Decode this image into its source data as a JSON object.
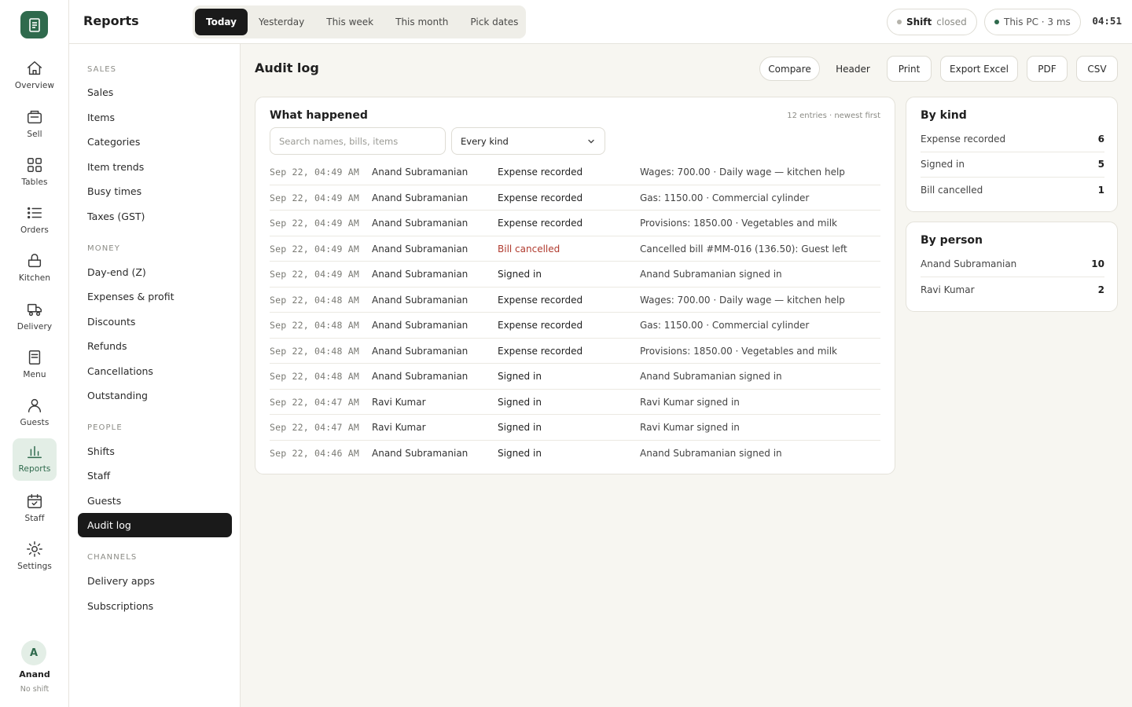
{
  "rail": {
    "items": [
      {
        "label": "Overview",
        "icon": "home-icon"
      },
      {
        "label": "Sell",
        "icon": "register-icon"
      },
      {
        "label": "Tables",
        "icon": "grid-icon"
      },
      {
        "label": "Orders",
        "icon": "list-icon"
      },
      {
        "label": "Kitchen",
        "icon": "pot-icon"
      },
      {
        "label": "Delivery",
        "icon": "truck-icon"
      },
      {
        "label": "Menu",
        "icon": "menu-icon"
      },
      {
        "label": "Guests",
        "icon": "person-icon"
      },
      {
        "label": "Reports",
        "icon": "bar-chart-icon"
      },
      {
        "label": "Staff",
        "icon": "calendar-check-icon"
      },
      {
        "label": "Settings",
        "icon": "sun-gear-icon"
      }
    ],
    "active": "Reports",
    "user": {
      "initial": "A",
      "name": "Anand",
      "shift": "No shift"
    }
  },
  "topbar": {
    "title": "Reports",
    "ranges": [
      "Today",
      "Yesterday",
      "This week",
      "This month",
      "Pick dates"
    ],
    "active_range": "Today",
    "shift": {
      "label": "Shift",
      "status": "closed"
    },
    "connection": "This PC · 3 ms",
    "clock": "04:51"
  },
  "subnav": {
    "sections": [
      {
        "title": "SALES",
        "items": [
          "Sales",
          "Items",
          "Categories",
          "Item trends",
          "Busy times",
          "Taxes (GST)"
        ]
      },
      {
        "title": "MONEY",
        "items": [
          "Day-end (Z)",
          "Expenses & profit",
          "Discounts",
          "Refunds",
          "Cancellations",
          "Outstanding"
        ]
      },
      {
        "title": "PEOPLE",
        "items": [
          "Shifts",
          "Staff",
          "Guests",
          "Audit log"
        ]
      },
      {
        "title": "CHANNELS",
        "items": [
          "Delivery apps",
          "Subscriptions"
        ]
      }
    ],
    "active": "Audit log"
  },
  "main": {
    "title": "Audit log",
    "actions": [
      "Compare",
      "Header",
      "Print",
      "Export Excel",
      "PDF",
      "CSV"
    ],
    "log": {
      "title": "What happened",
      "meta": "12 entries · newest first",
      "search_placeholder": "Search names, bills, items",
      "filter_value": "Every kind",
      "rows": [
        {
          "time": "Sep 22, 04:49 AM",
          "who": "Anand Subramanian",
          "kind": "Expense recorded",
          "detail": "Wages: 700.00 · Daily wage — kitchen help"
        },
        {
          "time": "Sep 22, 04:49 AM",
          "who": "Anand Subramanian",
          "kind": "Expense recorded",
          "detail": "Gas: 1150.00 · Commercial cylinder"
        },
        {
          "time": "Sep 22, 04:49 AM",
          "who": "Anand Subramanian",
          "kind": "Expense recorded",
          "detail": "Provisions: 1850.00 · Vegetables and milk"
        },
        {
          "time": "Sep 22, 04:49 AM",
          "who": "Anand Subramanian",
          "kind": "Bill cancelled",
          "detail": "Cancelled bill #MM-016 (136.50): Guest left",
          "alert": true
        },
        {
          "time": "Sep 22, 04:49 AM",
          "who": "Anand Subramanian",
          "kind": "Signed in",
          "detail": "Anand Subramanian signed in"
        },
        {
          "time": "Sep 22, 04:48 AM",
          "who": "Anand Subramanian",
          "kind": "Expense recorded",
          "detail": "Wages: 700.00 · Daily wage — kitchen help"
        },
        {
          "time": "Sep 22, 04:48 AM",
          "who": "Anand Subramanian",
          "kind": "Expense recorded",
          "detail": "Gas: 1150.00 · Commercial cylinder"
        },
        {
          "time": "Sep 22, 04:48 AM",
          "who": "Anand Subramanian",
          "kind": "Expense recorded",
          "detail": "Provisions: 1850.00 · Vegetables and milk"
        },
        {
          "time": "Sep 22, 04:48 AM",
          "who": "Anand Subramanian",
          "kind": "Signed in",
          "detail": "Anand Subramanian signed in"
        },
        {
          "time": "Sep 22, 04:47 AM",
          "who": "Ravi Kumar",
          "kind": "Signed in",
          "detail": "Ravi Kumar signed in"
        },
        {
          "time": "Sep 22, 04:47 AM",
          "who": "Ravi Kumar",
          "kind": "Signed in",
          "detail": "Ravi Kumar signed in"
        },
        {
          "time": "Sep 22, 04:46 AM",
          "who": "Anand Subramanian",
          "kind": "Signed in",
          "detail": "Anand Subramanian signed in"
        }
      ]
    },
    "by_kind": {
      "title": "By kind",
      "items": [
        {
          "label": "Expense recorded",
          "count": "6"
        },
        {
          "label": "Signed in",
          "count": "5"
        },
        {
          "label": "Bill cancelled",
          "count": "1"
        }
      ]
    },
    "by_person": {
      "title": "By person",
      "items": [
        {
          "label": "Anand Subramanian",
          "count": "10"
        },
        {
          "label": "Ravi Kumar",
          "count": "2"
        }
      ]
    }
  },
  "colors": {
    "brand": "#2f6a4d",
    "alert": "#b03a2e",
    "active_bg": "#1a1a1a"
  }
}
